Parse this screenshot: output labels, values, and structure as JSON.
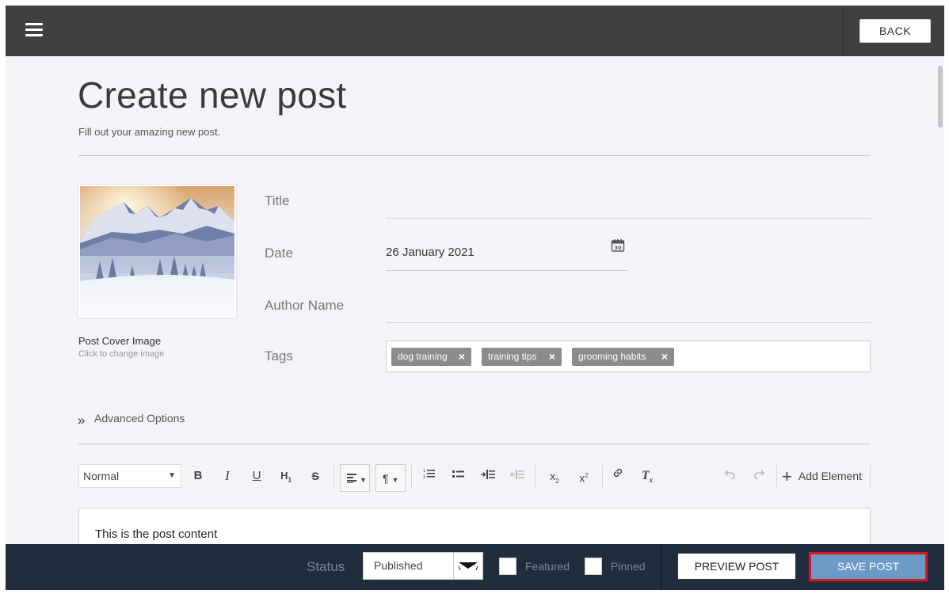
{
  "header": {
    "back_label": "BACK"
  },
  "page": {
    "title": "Create new post",
    "subtitle": "Fill out your amazing new post."
  },
  "cover": {
    "label": "Post Cover Image",
    "hint": "Click to change image"
  },
  "form": {
    "title_label": "Title",
    "title_value": "",
    "date_label": "Date",
    "date_value": "26 January 2021",
    "author_label": "Author Name",
    "author_value": "",
    "tags_label": "Tags",
    "tags": [
      "dog training",
      "training tips",
      "grooming habits"
    ],
    "tag_remove_glyph": "×"
  },
  "advanced": {
    "label": "Advanced Options"
  },
  "toolbar": {
    "block_format": "Normal",
    "bold": "B",
    "italic": "I",
    "underline": "U",
    "heading": "H",
    "strike": "S",
    "subscript": "x",
    "subscript_sub": "2",
    "superscript": "x",
    "superscript_sup": "2",
    "clear_format": "T",
    "clear_format_sub": "x",
    "add_element": "Add Element"
  },
  "editor": {
    "content": "This is the post content"
  },
  "footer": {
    "status_label": "Status",
    "status_value": "Published",
    "featured_label": "Featured",
    "pinned_label": "Pinned",
    "preview_label": "PREVIEW POST",
    "save_label": "SAVE POST"
  },
  "colors": {
    "topbar": "#404040",
    "bottombar": "#1f2d3d",
    "save_button": "#6b9ac7",
    "save_highlight": "#e0141e",
    "tag": "#8b8b8b"
  }
}
